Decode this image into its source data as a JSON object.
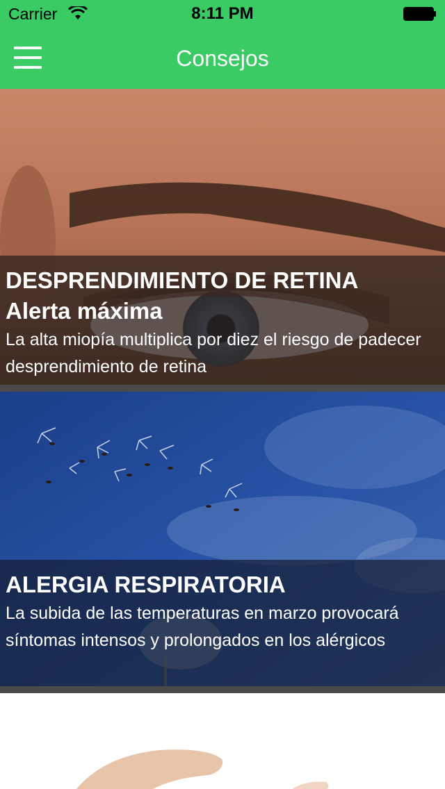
{
  "status_bar": {
    "carrier": "Carrier",
    "time": "8:11 PM",
    "icons": [
      "wifi-icon",
      "battery-icon"
    ]
  },
  "nav": {
    "title": "Consejos",
    "menu_icon": "hamburger-menu-icon"
  },
  "colors": {
    "brand_green": "#3acb64",
    "overlay_dark": "#28201c",
    "text_on_image": "#ffffff"
  },
  "articles": [
    {
      "title": "DESPRENDIMIENTO DE RETINA\nAlerta máxima",
      "description": "La alta miopía multiplica por diez el riesgo de padecer desprendimiento de retina",
      "image": "eye-closeup-photo"
    },
    {
      "title": "ALERGIA RESPIRATORIA",
      "description": "La subida de las temperaturas en marzo provocará síntomas intensos y prolongados en los alérgicos",
      "image": "dandelion-seeds-sky-photo"
    },
    {
      "image": "hand-photo"
    }
  ]
}
